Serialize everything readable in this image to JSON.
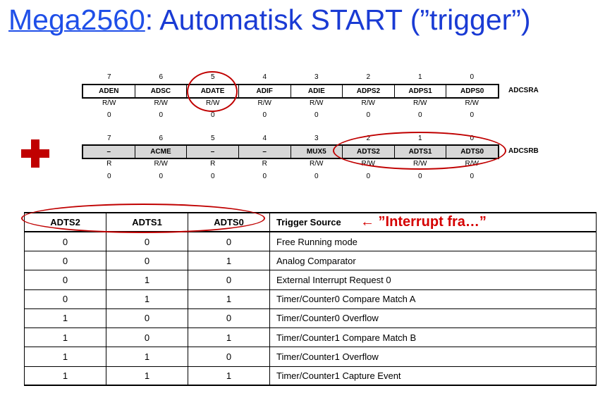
{
  "title": {
    "link": "Mega2560",
    "rest": ": Automatisk START (”trigger”)"
  },
  "adcsra": {
    "name": "ADCSRA",
    "bits": [
      "7",
      "6",
      "5",
      "4",
      "3",
      "2",
      "1",
      "0"
    ],
    "cells": [
      "ADEN",
      "ADSC",
      "ADATE",
      "ADIF",
      "ADIE",
      "ADPS2",
      "ADPS1",
      "ADPS0"
    ],
    "access": [
      "R/W",
      "R/W",
      "R/W",
      "R/W",
      "R/W",
      "R/W",
      "R/W",
      "R/W"
    ],
    "initial": [
      "0",
      "0",
      "0",
      "0",
      "0",
      "0",
      "0",
      "0"
    ]
  },
  "adcsrb": {
    "name": "ADCSRB",
    "bits": [
      "7",
      "6",
      "5",
      "4",
      "3",
      "2",
      "1",
      "0"
    ],
    "cells": [
      "–",
      "ACME",
      "–",
      "–",
      "MUX5",
      "ADTS2",
      "ADTS1",
      "ADTS0"
    ],
    "access": [
      "R",
      "R/W",
      "R",
      "R",
      "R/W",
      "R/W",
      "R/W",
      "R/W"
    ],
    "initial": [
      "0",
      "0",
      "0",
      "0",
      "0",
      "0",
      "0",
      "0"
    ]
  },
  "annotation": "←  ”Interrupt fra…”",
  "table": {
    "headers": [
      "ADTS2",
      "ADTS1",
      "ADTS0",
      "Trigger Source"
    ],
    "rows": [
      [
        "0",
        "0",
        "0",
        "Free Running mode"
      ],
      [
        "0",
        "0",
        "1",
        "Analog Comparator"
      ],
      [
        "0",
        "1",
        "0",
        "External Interrupt Request 0"
      ],
      [
        "0",
        "1",
        "1",
        "Timer/Counter0 Compare Match A"
      ],
      [
        "1",
        "0",
        "0",
        "Timer/Counter0 Overflow"
      ],
      [
        "1",
        "0",
        "1",
        "Timer/Counter1 Compare Match B"
      ],
      [
        "1",
        "1",
        "0",
        "Timer/Counter1 Overflow"
      ],
      [
        "1",
        "1",
        "1",
        "Timer/Counter1 Capture Event"
      ]
    ]
  },
  "colors": {
    "title": "#1a3bd4",
    "highlight": "#c00000",
    "annotation": "#d50000",
    "shaded": "#d7d7d7"
  }
}
